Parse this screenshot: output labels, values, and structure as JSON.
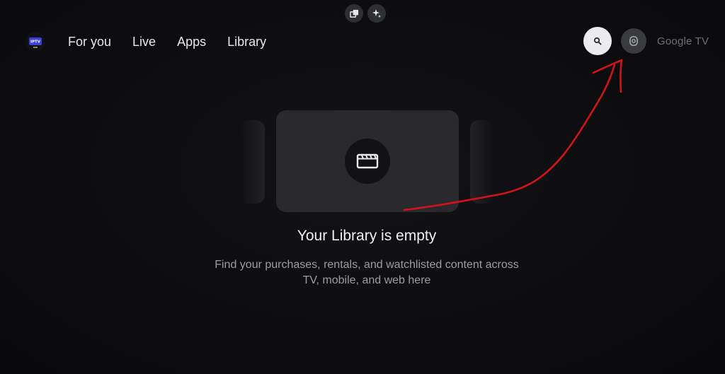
{
  "nav": {
    "profile_logo_text": "IPTV",
    "tabs": [
      {
        "label": "For you"
      },
      {
        "label": "Live"
      },
      {
        "label": "Apps"
      },
      {
        "label": "Library"
      }
    ]
  },
  "brand": {
    "label": "Google TV"
  },
  "icons": {
    "pip": "picture-in-picture-icon",
    "sparkle": "sparkle-icon",
    "search": "search-icon",
    "settings": "gear-icon",
    "library": "film-icon"
  },
  "library": {
    "empty_title": "Your Library is empty",
    "empty_description": "Find your purchases, rentals, and watchlisted content across TV, mobile, and web here"
  },
  "colors": {
    "background": "#0c0c0f",
    "card": "#2a2a2e",
    "search_button": "#ececee",
    "annotation_arrow": "#d0141a"
  }
}
